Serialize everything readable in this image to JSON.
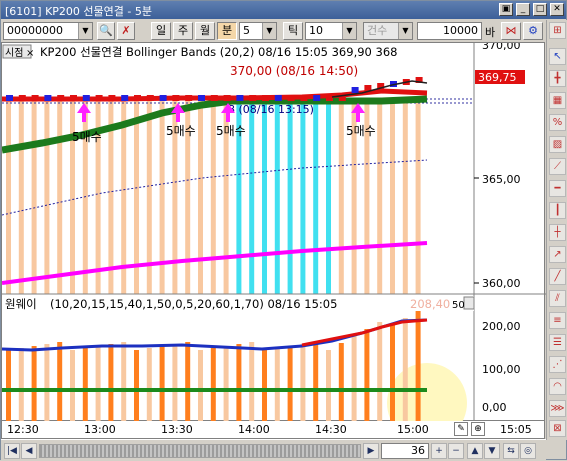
{
  "title": "[6101] KP200 선물연결 - 5분 ",
  "toolbar": {
    "code": "00000000",
    "period_buttons": [
      "일",
      "주",
      "월",
      "분"
    ],
    "minute_value": "5",
    "tick_label": "틱",
    "tick_value": "10",
    "count_label": "건수",
    "count_value": "10000",
    "count_unit": "바"
  },
  "upper_chart": {
    "tag": "시점",
    "header": "KP200 선물연결 Bollinger Bands  (20,2) 08/16 15:05  369,90  368",
    "high_label": "370,00 (08/16 14:50)",
    "current_value": "369,75",
    "y_axis_labels": [
      "370,00",
      "365,00",
      "360,00"
    ],
    "signal_labels": [
      "5매수",
      "5매수",
      "5매수",
      "5매수"
    ],
    "partial_label": "8 (08/16 13:15)"
  },
  "lower_chart": {
    "tag": "원웨이",
    "header": "(10,20,15,15,40,1,50,0,5,20,60,1,70) 08/16 15:05",
    "value_label": "208,40",
    "badge": "50",
    "y_axis_labels": [
      "200,00",
      "100,00",
      "0,00"
    ]
  },
  "time_axis": [
    "12:30",
    "13:00",
    "13:30",
    "14:00",
    "14:30",
    "15:00",
    "15:05"
  ],
  "bottom": {
    "zoom_value": "36"
  },
  "colors": {
    "bar_fill": "#f8c8a0",
    "bar_orange": "#ff7f1e",
    "upper_band": "#ff00ff",
    "middle_band": "#1c7a1c",
    "price_red": "#e01010",
    "price_blue": "#2020e0",
    "signal_magenta": "#ff20ff",
    "cyan": "#40e0f0"
  }
}
